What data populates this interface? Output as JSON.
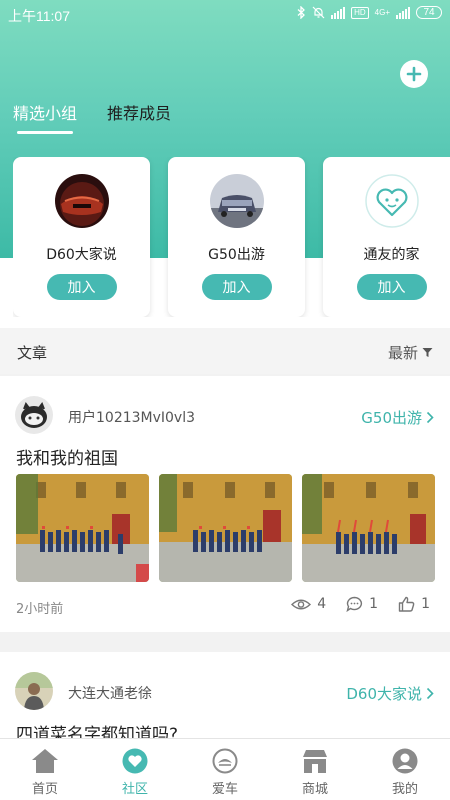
{
  "statusbar": {
    "time": "上午11:07",
    "hd": "HD",
    "net": "4G+",
    "battery": "74"
  },
  "tabs": [
    {
      "label": "精选小组",
      "active": true
    },
    {
      "label": "推荐成员",
      "active": false
    }
  ],
  "groups": [
    {
      "name": "D60大家说",
      "join": "加入"
    },
    {
      "name": "G50出游",
      "join": "加入"
    },
    {
      "name": "通友的家",
      "join": "加入"
    }
  ],
  "section": {
    "title": "文章",
    "sort": "最新"
  },
  "posts": [
    {
      "user": "用户10213MvI0vl3",
      "group": "G50出游",
      "title": "我和我的祖国",
      "time": "2小时前",
      "views": "4",
      "comments": "1",
      "likes": "1"
    },
    {
      "user": "大连大通老徐",
      "group": "D60大家说",
      "title": "四道菜名字都知道吗?"
    }
  ],
  "nav": [
    {
      "label": "首页",
      "icon": "home-icon"
    },
    {
      "label": "社区",
      "icon": "community-icon",
      "active": true
    },
    {
      "label": "爱车",
      "icon": "car-icon"
    },
    {
      "label": "商城",
      "icon": "store-icon"
    },
    {
      "label": "我的",
      "icon": "profile-icon"
    }
  ],
  "colors": {
    "accent": "#46b9b2",
    "hero_top": "#7fdcc0",
    "hero_bottom": "#3dbaa6"
  }
}
